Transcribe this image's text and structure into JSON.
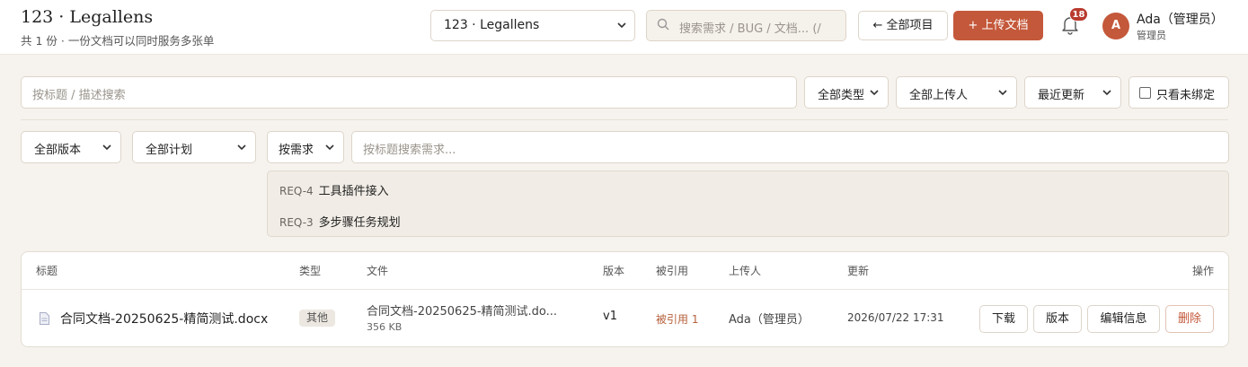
{
  "header": {
    "title": "123 · Legallens",
    "subtitle": "共 1 份 · 一份文档可以同时服务多张单",
    "project_select": "123 · Legallens",
    "search_placeholder": "搜索需求 / BUG / 文档...  (/",
    "back_label": "← 全部项目",
    "upload_label": "+  上传文档",
    "notification_count": "18",
    "avatar_initial": "A",
    "user_name": "Ada（管理员）",
    "user_role": "管理员"
  },
  "filters": {
    "search_placeholder": "按标题 / 描述搜索",
    "type": "全部类型",
    "uploader": "全部上传人",
    "sort": "最近更新",
    "unbound_only": "只看未绑定",
    "version": "全部版本",
    "plan": "全部计划",
    "by": "按需求",
    "req_search_placeholder": "按标题搜索需求..."
  },
  "requirements": [
    {
      "key": "REQ-4",
      "title": "工具插件接入"
    },
    {
      "key": "REQ-3",
      "title": "多步骤任务规划"
    }
  ],
  "table": {
    "columns": {
      "title": "标题",
      "type": "类型",
      "file": "文件",
      "version": "版本",
      "refs": "被引用",
      "uploader": "上传人",
      "updated": "更新",
      "actions": "操作"
    },
    "rows": [
      {
        "title": "合同文档-20250625-精简测试.docx",
        "type": "其他",
        "file_name": "合同文档-20250625-精简测试.do...",
        "file_size": "356 KB",
        "version": "v1",
        "refs": "被引用 1",
        "uploader": "Ada（管理员）",
        "updated": "2026/07/22 17:31",
        "actions": {
          "download": "下载",
          "version": "版本",
          "edit": "编辑信息",
          "delete": "删除"
        }
      }
    ]
  },
  "colors": {
    "accent": "#c4583a",
    "background": "#f6f3ee",
    "badge": "#b93b2e"
  }
}
